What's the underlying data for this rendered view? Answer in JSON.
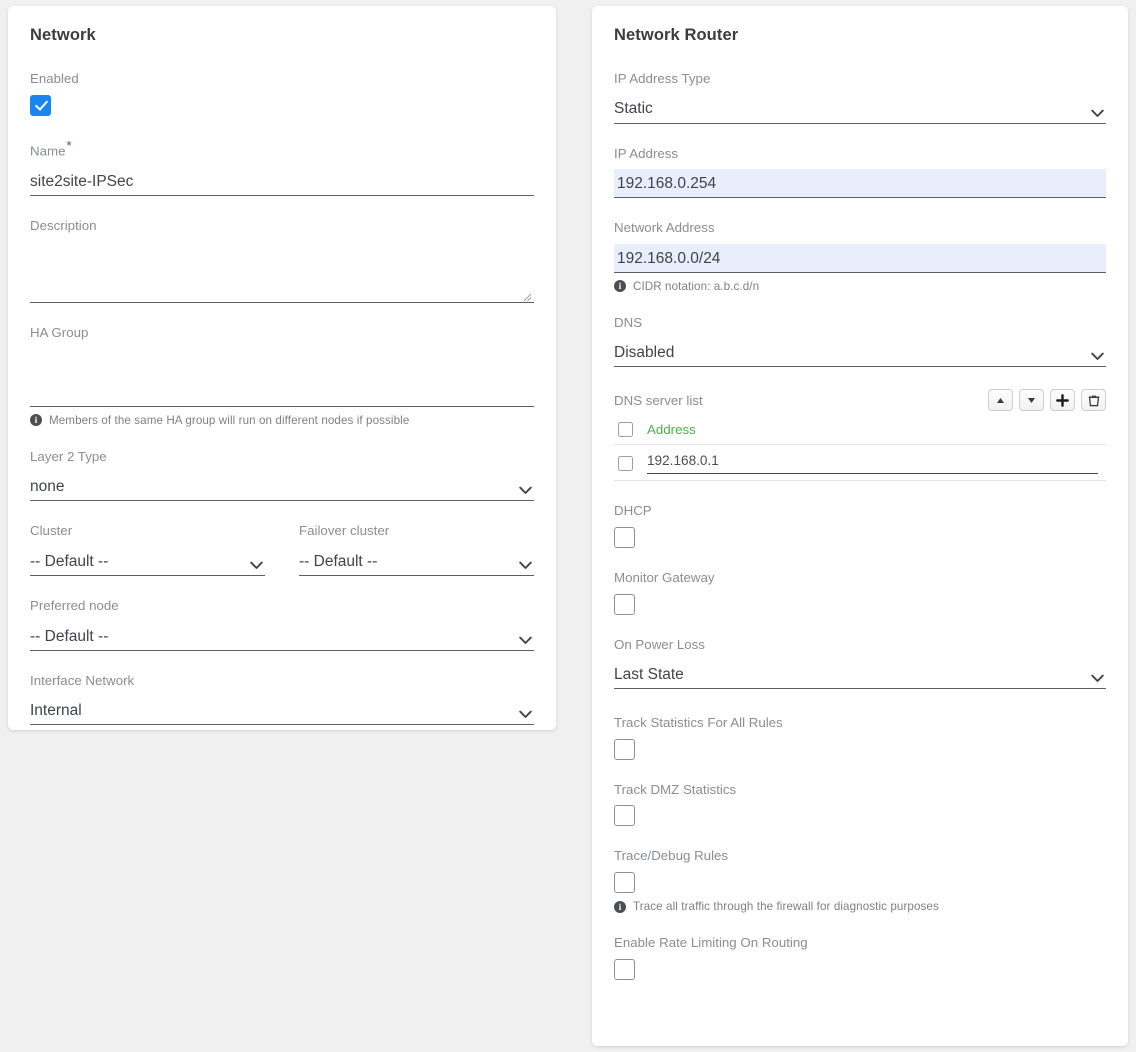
{
  "network_card": {
    "title": "Network",
    "enabled": {
      "label": "Enabled",
      "checked": true
    },
    "name": {
      "label": "Name",
      "required_marker": "*",
      "value": "site2site-IPSec"
    },
    "description": {
      "label": "Description",
      "value": ""
    },
    "ha_group": {
      "label": "HA Group",
      "value": "",
      "hint": "Members of the same HA group will run on different nodes if possible",
      "info_glyph": "i"
    },
    "layer2_type": {
      "label": "Layer 2 Type",
      "value": "none"
    },
    "cluster": {
      "label": "Cluster",
      "value": "-- Default --"
    },
    "failover_cluster": {
      "label": "Failover cluster",
      "value": "-- Default --"
    },
    "preferred_node": {
      "label": "Preferred node",
      "value": "-- Default --"
    },
    "interface_network": {
      "label": "Interface Network",
      "value": "Internal"
    }
  },
  "router_card": {
    "title": "Network Router",
    "ip_address_type": {
      "label": "IP Address Type",
      "value": "Static"
    },
    "ip_address": {
      "label": "IP Address",
      "value": "192.168.0.254"
    },
    "network_address": {
      "label": "Network Address",
      "value": "192.168.0.0/24",
      "hint": "CIDR notation: a.b.c.d/n",
      "info_glyph": "i"
    },
    "dns": {
      "label": "DNS",
      "value": "Disabled"
    },
    "dns_server_list": {
      "label": "DNS server list",
      "tools": [
        {
          "name": "move-up",
          "glyph": "up"
        },
        {
          "name": "move-down",
          "glyph": "down"
        },
        {
          "name": "add",
          "glyph": "plus"
        },
        {
          "name": "delete",
          "glyph": "trash"
        }
      ],
      "columns": [
        "Address"
      ],
      "rows": [
        {
          "address": "192.168.0.1",
          "selected": false
        }
      ],
      "header_selected": false
    },
    "dhcp": {
      "label": "DHCP",
      "checked": false
    },
    "monitor_gateway": {
      "label": "Monitor Gateway",
      "checked": false
    },
    "on_power_loss": {
      "label": "On Power Loss",
      "value": "Last State"
    },
    "track_statistics_all_rules": {
      "label": "Track Statistics For All Rules",
      "checked": false
    },
    "track_dmz_statistics": {
      "label": "Track DMZ Statistics",
      "checked": false
    },
    "trace_debug_rules": {
      "label": "Trace/Debug Rules",
      "checked": false,
      "hint": "Trace all traffic through the firewall for diagnostic purposes",
      "info_glyph": "i"
    },
    "enable_rate_limiting": {
      "label": "Enable Rate Limiting On Routing",
      "checked": false
    }
  },
  "colors": {
    "page_background": "#f0f0f0",
    "card_background": "#ffffff",
    "label_text": "#8a8d91",
    "value_text": "#3f4448",
    "checkbox_checked": "#1a85f0",
    "required_star": "#a03232",
    "column_header_green": "#4caf50",
    "highlight_field": "#e8eefb",
    "underline": "#5e5e5e"
  }
}
